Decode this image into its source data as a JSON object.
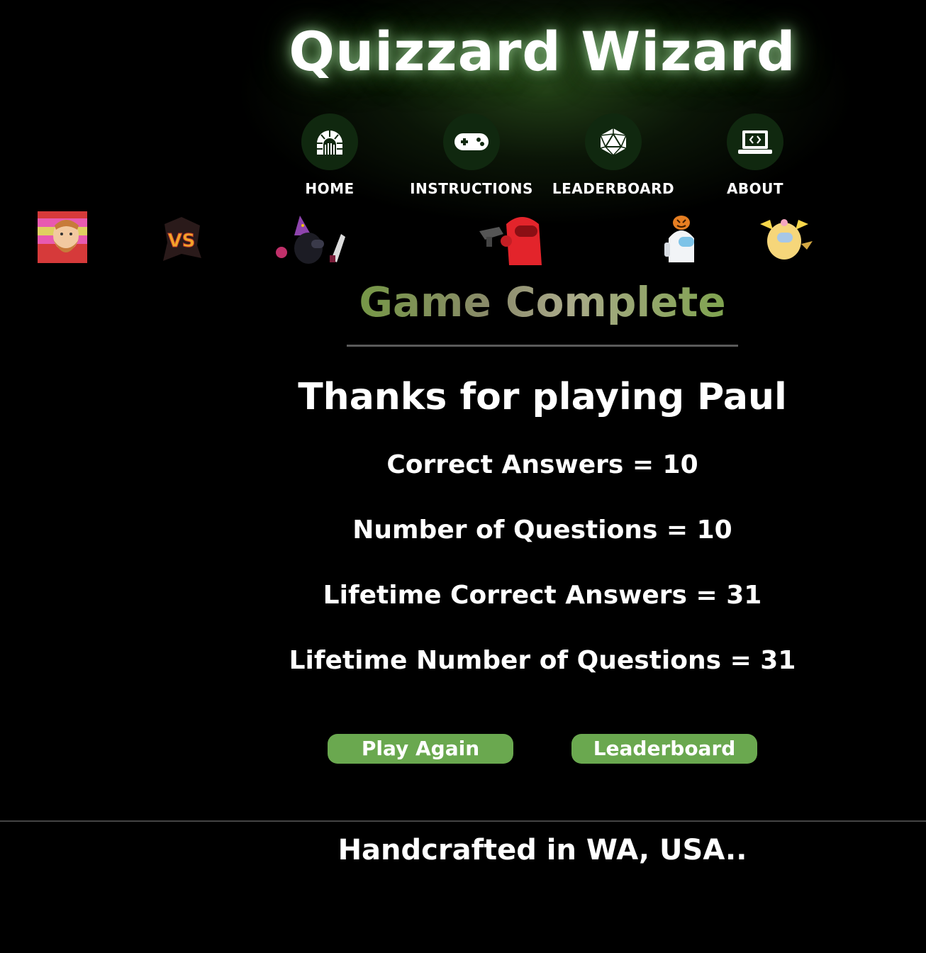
{
  "site": {
    "title": "Quizzard Wizard"
  },
  "nav": {
    "items": [
      {
        "label": "HOME",
        "icon": "dungeon-icon"
      },
      {
        "label": "INSTRUCTIONS",
        "icon": "gamepad-icon"
      },
      {
        "label": "LEADERBOARD",
        "icon": "d20-dice-icon"
      },
      {
        "label": "ABOUT",
        "icon": "laptop-code-icon"
      }
    ]
  },
  "sprites": {
    "vs_text": "VS"
  },
  "results": {
    "heading": "Game Complete",
    "thanks": "Thanks for playing Paul",
    "correct_answers": "Correct Answers = 10",
    "number_of_questions": "Number of Questions = 10",
    "lifetime_correct": "Lifetime Correct Answers = 31",
    "lifetime_questions": "Lifetime Number of Questions = 31"
  },
  "buttons": {
    "play_again": "Play Again",
    "leaderboard": "Leaderboard"
  },
  "footer": {
    "text": "Handcrafted in WA, USA.."
  },
  "colors": {
    "background": "#000000",
    "accent_green": "#6aa84f",
    "nav_circle": "#10280f",
    "divider": "#5a5a5a"
  }
}
